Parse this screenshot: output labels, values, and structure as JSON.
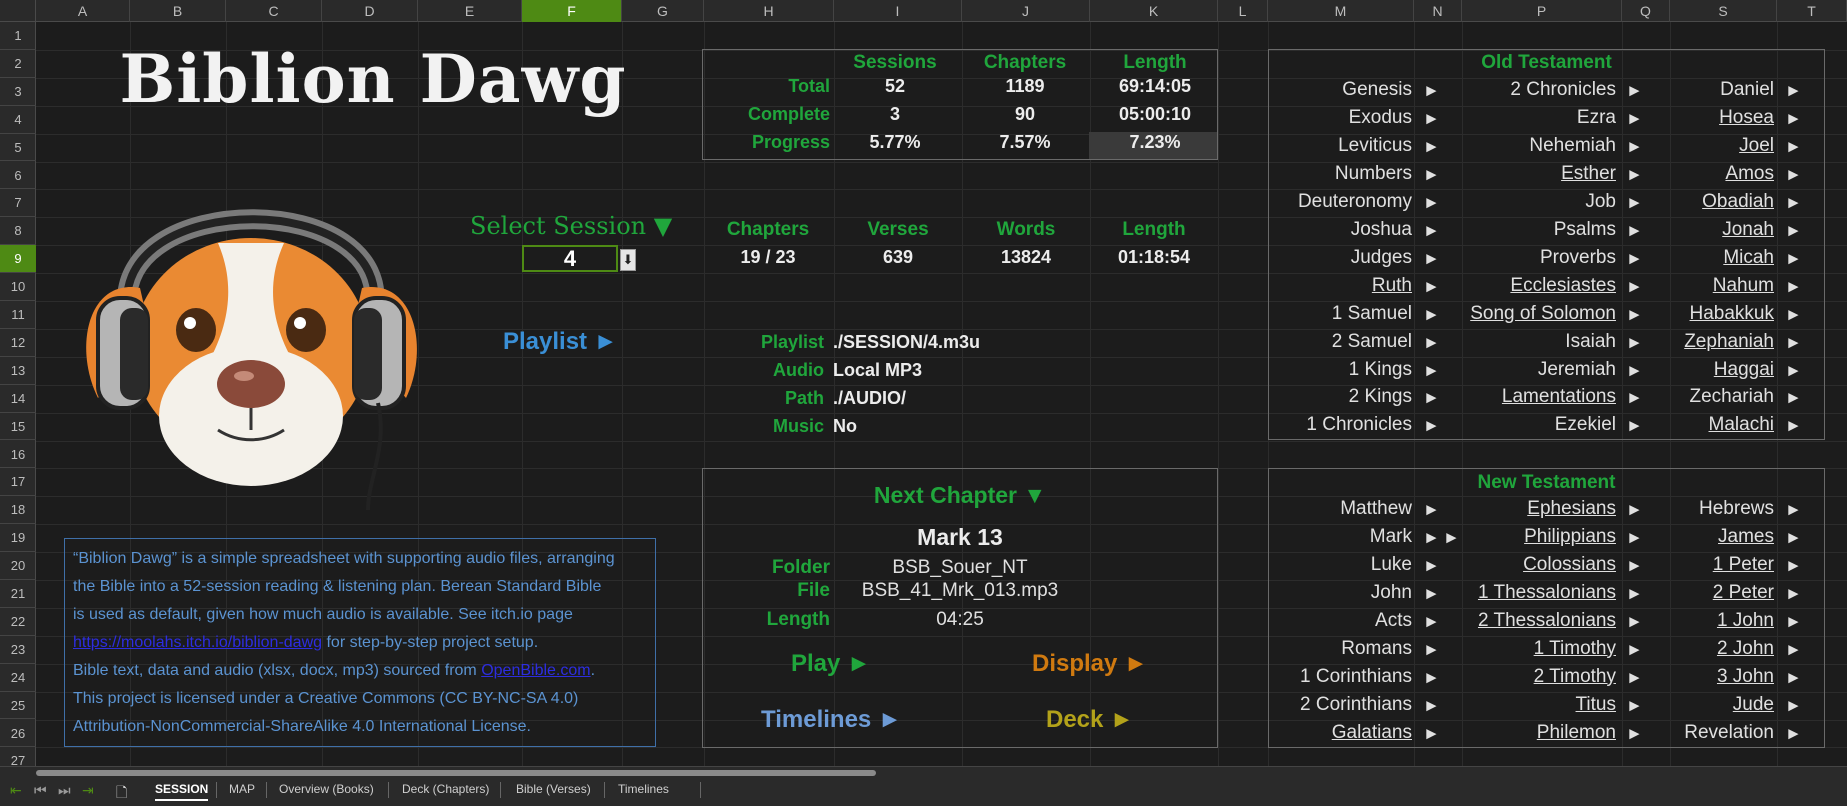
{
  "columns": [
    "A",
    "B",
    "C",
    "D",
    "E",
    "F",
    "G",
    "H",
    "I",
    "J",
    "K",
    "L",
    "M",
    "N",
    "P",
    "Q",
    "S",
    "T"
  ],
  "rows": [
    "1",
    "2",
    "3",
    "4",
    "5",
    "6",
    "7",
    "8",
    "9",
    "10",
    "11",
    "12",
    "13",
    "14",
    "15",
    "16",
    "17",
    "18",
    "19",
    "20",
    "21",
    "22",
    "23",
    "24",
    "25",
    "26",
    "27"
  ],
  "title": "Biblion Dawg",
  "select_session": {
    "label": "Select Session ▼",
    "value": "4",
    "button": "⬇"
  },
  "playlist_link": "Playlist  ►",
  "stats": {
    "headers": [
      "Sessions",
      "Chapters",
      "Length"
    ],
    "rows": [
      {
        "label": "Total",
        "sessions": "52",
        "chapters": "1189",
        "length": "69:14:05"
      },
      {
        "label": "Complete",
        "sessions": "3",
        "chapters": "90",
        "length": "05:00:10"
      },
      {
        "label": "Progress",
        "sessions": "5.77%",
        "chapters": "7.57%",
        "length": "7.23%"
      }
    ]
  },
  "session_stats": {
    "headers": [
      "Chapters",
      "Verses",
      "Words",
      "Length"
    ],
    "values": [
      "19 / 23",
      "639",
      "13824",
      "01:18:54"
    ]
  },
  "playlist_info": [
    {
      "label": "Playlist",
      "value": "./SESSION/4.m3u"
    },
    {
      "label": "Audio",
      "value": "Local MP3"
    },
    {
      "label": "Path",
      "value": "./AUDIO/"
    },
    {
      "label": "Music",
      "value": "No"
    }
  ],
  "next_chapter": {
    "header": "Next Chapter ▼",
    "chapter": "Mark 13",
    "folder_label": "Folder",
    "folder": "BSB_Souer_NT",
    "file_label": "File",
    "file": "BSB_41_Mrk_013.mp3",
    "length_label": "Length",
    "length": "04:25",
    "play": "Play ►",
    "display": "Display ►",
    "timelines": "Timelines ►",
    "deck": "Deck ►"
  },
  "old_testament": {
    "title": "Old Testament",
    "col1": [
      {
        "name": "Genesis",
        "u": false
      },
      {
        "name": "Exodus",
        "u": false
      },
      {
        "name": "Leviticus",
        "u": false
      },
      {
        "name": "Numbers",
        "u": false
      },
      {
        "name": "Deuteronomy",
        "u": false
      },
      {
        "name": "Joshua",
        "u": false
      },
      {
        "name": "Judges",
        "u": false
      },
      {
        "name": "Ruth",
        "u": true
      },
      {
        "name": "1 Samuel",
        "u": false
      },
      {
        "name": "2 Samuel",
        "u": false
      },
      {
        "name": "1 Kings",
        "u": false
      },
      {
        "name": "2 Kings",
        "u": false
      },
      {
        "name": "1 Chronicles",
        "u": false
      }
    ],
    "col2": [
      {
        "name": "2 Chronicles",
        "u": false
      },
      {
        "name": "Ezra",
        "u": false
      },
      {
        "name": "Nehemiah",
        "u": false
      },
      {
        "name": "Esther",
        "u": true
      },
      {
        "name": "Job",
        "u": false
      },
      {
        "name": "Psalms",
        "u": false
      },
      {
        "name": "Proverbs",
        "u": false
      },
      {
        "name": "Ecclesiastes",
        "u": true
      },
      {
        "name": "Song of Solomon",
        "u": true
      },
      {
        "name": "Isaiah",
        "u": false
      },
      {
        "name": "Jeremiah",
        "u": false
      },
      {
        "name": "Lamentations",
        "u": true
      },
      {
        "name": "Ezekiel",
        "u": false
      }
    ],
    "col3": [
      {
        "name": "Daniel",
        "u": false
      },
      {
        "name": "Hosea",
        "u": true
      },
      {
        "name": "Joel",
        "u": true
      },
      {
        "name": "Amos",
        "u": true
      },
      {
        "name": "Obadiah",
        "u": true
      },
      {
        "name": "Jonah",
        "u": true
      },
      {
        "name": "Micah",
        "u": true
      },
      {
        "name": "Nahum",
        "u": true
      },
      {
        "name": "Habakkuk",
        "u": true
      },
      {
        "name": "Zephaniah",
        "u": true
      },
      {
        "name": "Haggai",
        "u": true
      },
      {
        "name": "Zechariah",
        "u": false
      },
      {
        "name": "Malachi",
        "u": true
      }
    ]
  },
  "new_testament": {
    "title": "New Testament",
    "col1": [
      {
        "name": "Matthew",
        "u": false
      },
      {
        "name": "Mark",
        "u": false
      },
      {
        "name": "Luke",
        "u": false
      },
      {
        "name": "John",
        "u": false
      },
      {
        "name": "Acts",
        "u": false
      },
      {
        "name": "Romans",
        "u": false
      },
      {
        "name": "1 Corinthians",
        "u": false
      },
      {
        "name": "2 Corinthians",
        "u": false
      },
      {
        "name": "Galatians",
        "u": true
      }
    ],
    "col2": [
      {
        "name": "Ephesians",
        "u": true
      },
      {
        "name": "Philippians",
        "u": true
      },
      {
        "name": "Colossians",
        "u": true
      },
      {
        "name": "1 Thessalonians",
        "u": true
      },
      {
        "name": "2 Thessalonians",
        "u": true
      },
      {
        "name": "1 Timothy",
        "u": true
      },
      {
        "name": "2 Timothy",
        "u": true
      },
      {
        "name": "Titus",
        "u": true
      },
      {
        "name": "Philemon",
        "u": true
      }
    ],
    "col3": [
      {
        "name": "Hebrews",
        "u": false
      },
      {
        "name": "James",
        "u": true
      },
      {
        "name": "1 Peter",
        "u": true
      },
      {
        "name": "2 Peter",
        "u": true
      },
      {
        "name": "1 John",
        "u": true
      },
      {
        "name": "2 John",
        "u": true
      },
      {
        "name": "3 John",
        "u": true
      },
      {
        "name": "Jude",
        "u": true
      },
      {
        "name": "Revelation",
        "u": false
      }
    ]
  },
  "arrow": "►",
  "current_marker": "►",
  "info": {
    "line1": "“Biblion Dawg” is a simple spreadsheet with supporting audio files, arranging",
    "line2": "the Bible into a 52-session reading & listening plan. Berean Standard Bible",
    "line3": "is used as default, given how much audio is available. See itch.io page",
    "link1": "https://moolahs.itch.io/biblion-dawg",
    "line4_rest": " for step-by-step project setup.",
    "line5_pre": "Bible text, data and audio (xlsx, docx, mp3) sourced from ",
    "link2": "OpenBible.com",
    "line5_post": ".",
    "line6": "This project is licensed under a Creative Commons (CC BY-NC-SA 4.0)",
    "line7": "Attribution-NonCommercial-ShareAlike 4.0 International License."
  },
  "sheet_tabs": [
    "SESSION",
    "MAP",
    "Overview (Books)",
    "Deck (Chapters)",
    "Bible (Verses)",
    "Timelines"
  ],
  "active_tab": "SESSION",
  "colors": {
    "green": "#20a63c",
    "blue": "#3a8fd6",
    "orange": "#d07a10",
    "olive": "#b3a21a",
    "steel": "#6d9bd6",
    "select_green": "#4e8a14"
  }
}
